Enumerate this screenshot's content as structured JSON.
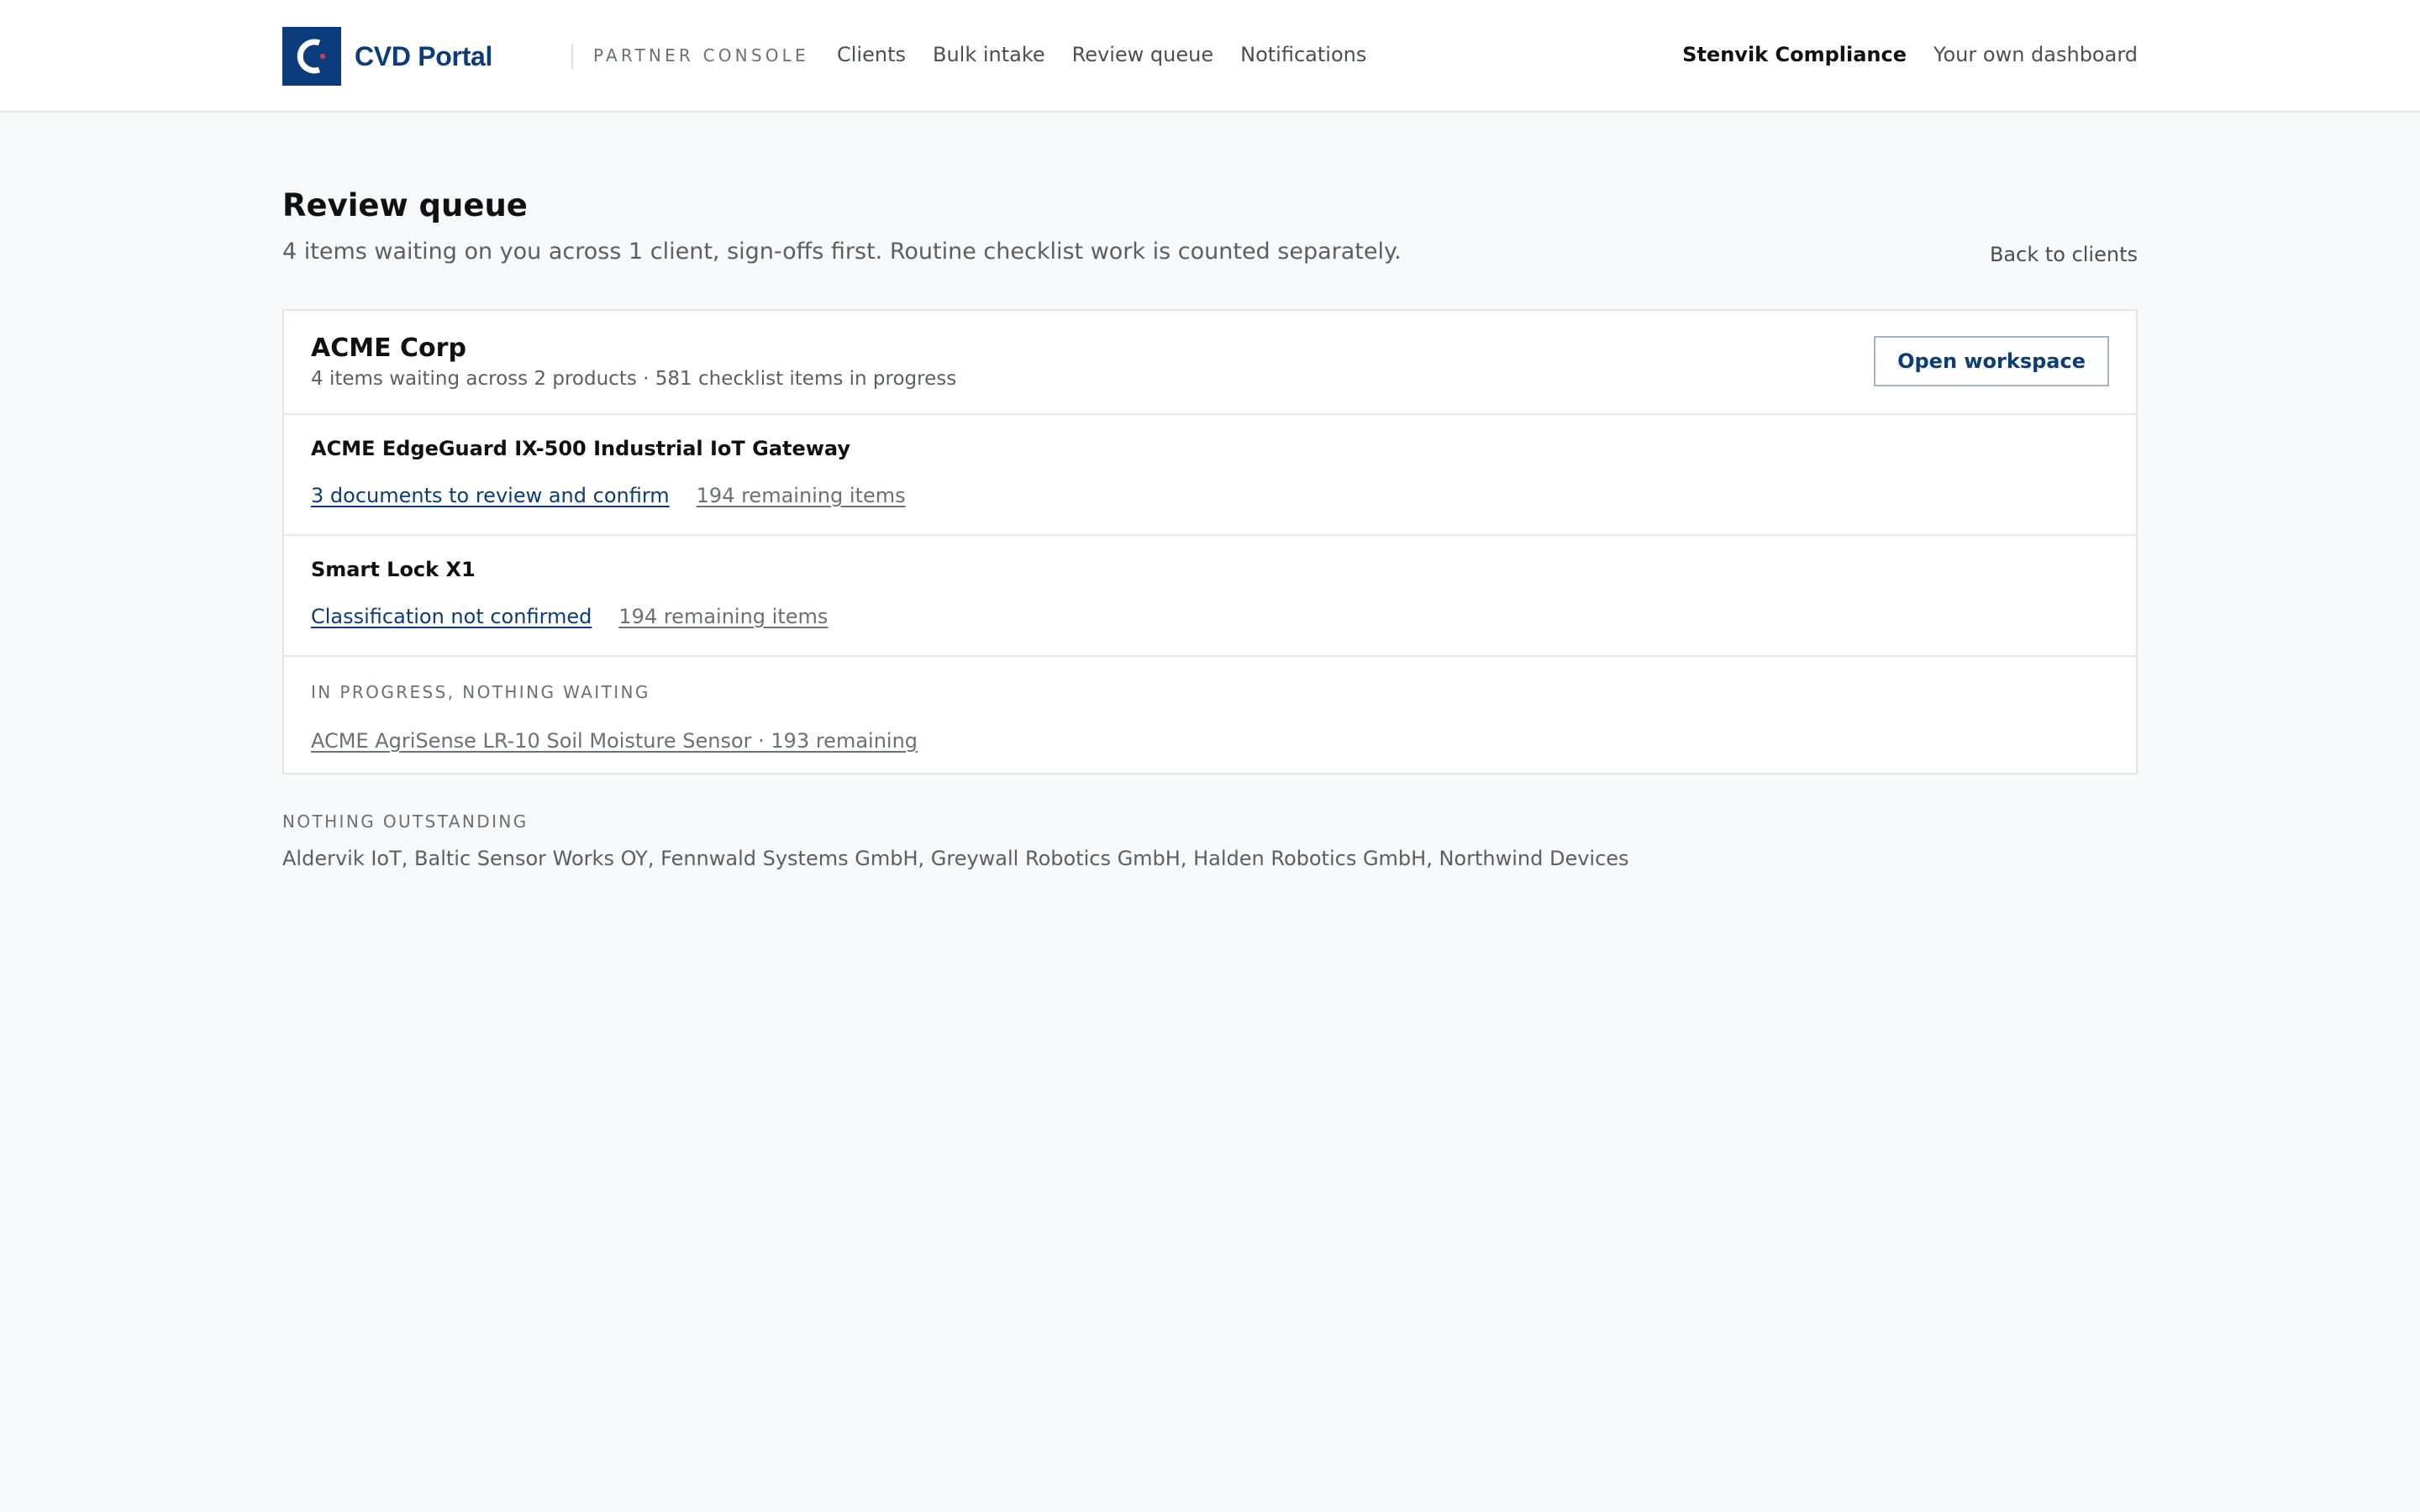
{
  "brand": {
    "name": "CVD Portal",
    "console_label": "PARTNER CONSOLE",
    "color": "#0b3c7d"
  },
  "nav": {
    "items": [
      {
        "label": "Clients"
      },
      {
        "label": "Bulk intake"
      },
      {
        "label": "Review queue"
      },
      {
        "label": "Notifications"
      }
    ],
    "org_name": "Stenvik Compliance",
    "own_dashboard": "Your own dashboard"
  },
  "page": {
    "title": "Review queue",
    "subtitle": "4 items waiting on you across 1 client, sign-offs first. Routine checklist work is counted separately.",
    "back_link": "Back to clients"
  },
  "client": {
    "name": "ACME Corp",
    "meta": "4 items waiting across 2 products · 581 checklist items in progress",
    "open_button": "Open workspace",
    "products": [
      {
        "name": "ACME EdgeGuard IX-500 Industrial IoT Gateway",
        "action": "3 documents to review and confirm",
        "remaining": "194 remaining items"
      },
      {
        "name": "Smart Lock X1",
        "action": "Classification not confirmed",
        "remaining": "194 remaining items"
      }
    ],
    "in_progress": {
      "label": "IN PROGRESS, NOTHING WAITING",
      "item": "ACME AgriSense LR-10 Soil Moisture Sensor · 193 remaining"
    }
  },
  "nothing_outstanding": {
    "label": "NOTHING OUTSTANDING",
    "clients": "Aldervik IoT, Baltic Sensor Works OY, Fennwald Systems GmbH, Greywall Robotics GmbH, Halden Robotics GmbH, Northwind Devices"
  }
}
